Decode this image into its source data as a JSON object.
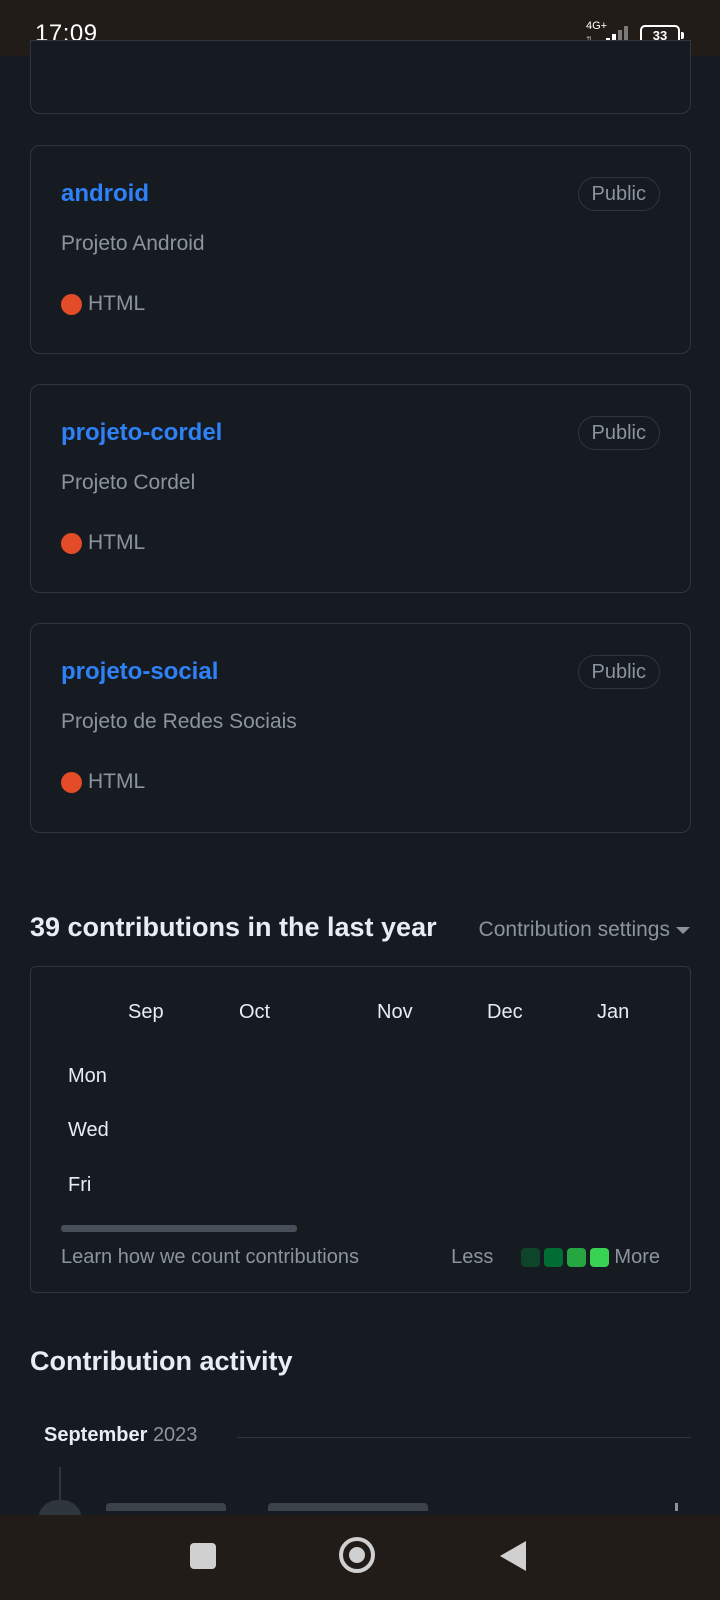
{
  "status_bar": {
    "time": "17:09",
    "network": "4G+",
    "battery": "33"
  },
  "repos": [
    {
      "name": "android",
      "visibility": "Public",
      "description": "Projeto Android",
      "language": "HTML",
      "language_color": "#e34c26"
    },
    {
      "name": "projeto-cordel",
      "visibility": "Public",
      "description": "Projeto Cordel",
      "language": "HTML",
      "language_color": "#e34c26"
    },
    {
      "name": "projeto-social",
      "visibility": "Public",
      "description": "Projeto de Redes Sociais",
      "language": "HTML",
      "language_color": "#e34c26"
    }
  ],
  "contributions": {
    "title": "39 contributions in the last year",
    "settings_label": "Contribution settings",
    "months": [
      "Sep",
      "Oct",
      "Nov",
      "Dec",
      "Jan"
    ],
    "days": [
      "Mon",
      "Wed",
      "Fri"
    ],
    "learn_link": "Learn how we count contributions",
    "legend_less": "Less",
    "legend_more": "More",
    "legend_colors": [
      "#0e4429",
      "#006d32",
      "#26a641",
      "#39d353"
    ]
  },
  "activity": {
    "title": "Contribution activity",
    "month": "September",
    "year": "2023"
  },
  "colors": {
    "accent": "#2f81f7",
    "background": "#161b22",
    "border": "#30363d",
    "muted": "#8b949e"
  }
}
